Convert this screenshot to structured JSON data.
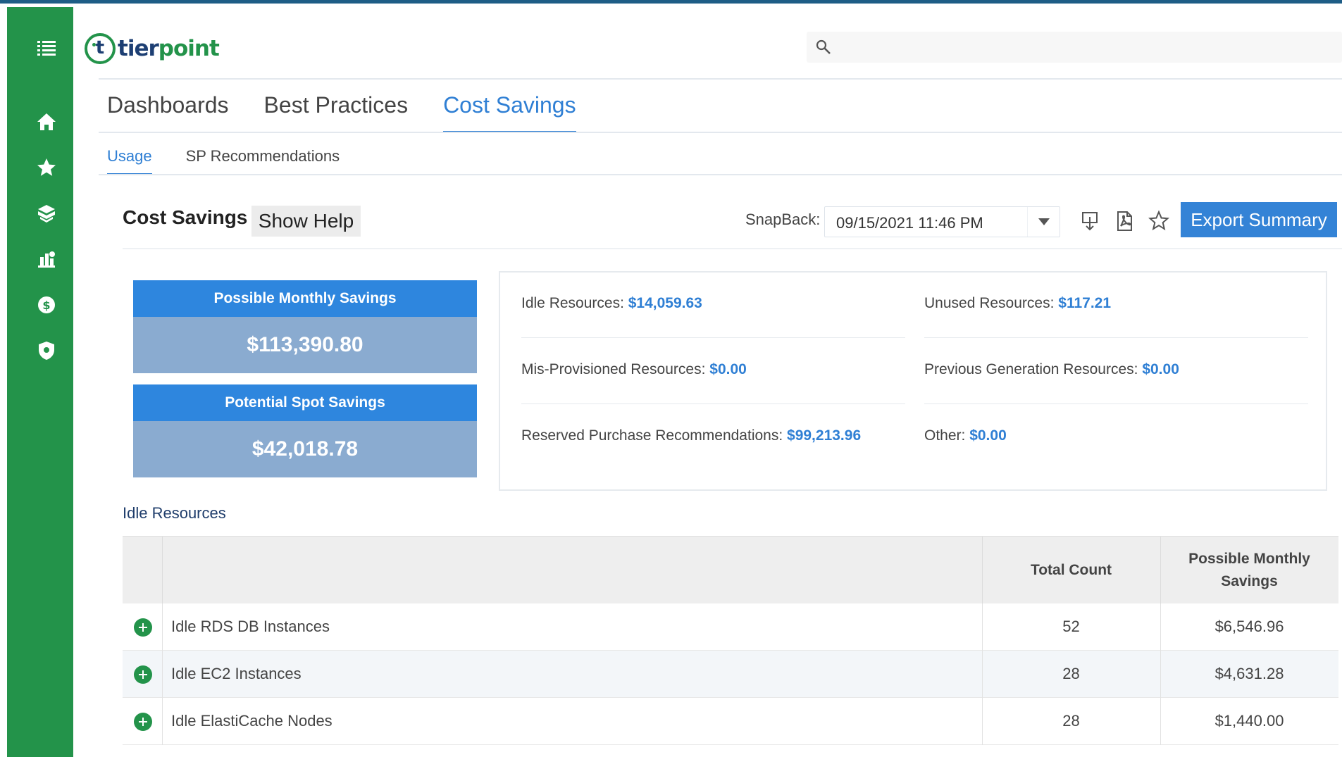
{
  "logo": {
    "mark_letter": "t",
    "text_part1": "tier",
    "text_part2": "point"
  },
  "search": {
    "placeholder": ""
  },
  "sidebar": {
    "items": [
      {
        "icon": "menu-icon"
      },
      {
        "icon": "home-icon"
      },
      {
        "icon": "star-icon"
      },
      {
        "icon": "cubes-icon"
      },
      {
        "icon": "building-icon"
      },
      {
        "icon": "dollar-circle-icon"
      },
      {
        "icon": "shield-icon"
      }
    ]
  },
  "main_tabs": [
    {
      "label": "Dashboards",
      "active": false
    },
    {
      "label": "Best Practices",
      "active": false
    },
    {
      "label": "Cost Savings",
      "active": true
    }
  ],
  "sub_tabs": [
    {
      "label": "Usage",
      "active": true
    },
    {
      "label": "SP Recommendations",
      "active": false
    }
  ],
  "toolbar": {
    "title": "Cost Savings",
    "show_help": "Show Help",
    "snapback_label": "SnapBack:",
    "snapback_value": "09/15/2021 11:46 PM",
    "export_label": "Export Summary"
  },
  "cards": [
    {
      "title": "Possible Monthly Savings",
      "value": "$113,390.80"
    },
    {
      "title": "Potential Spot Savings",
      "value": "$42,018.78"
    }
  ],
  "summary": [
    {
      "label": "Idle Resources: ",
      "value": "$14,059.63"
    },
    {
      "label": "Unused Resources: ",
      "value": "$117.21"
    },
    {
      "label": "Mis-Provisioned Resources: ",
      "value": "$0.00"
    },
    {
      "label": "Previous Generation Resources: ",
      "value": "$0.00"
    },
    {
      "label": "Reserved Purchase Recommendations: ",
      "value": "$99,213.96"
    },
    {
      "label": "Other: ",
      "value": "$0.00"
    }
  ],
  "idle_section": {
    "title": "Idle Resources",
    "columns": {
      "total_count": "Total Count",
      "savings_line1": "Possible Monthly",
      "savings_line2": "Savings"
    },
    "rows": [
      {
        "name": "Idle RDS DB Instances",
        "count": "52",
        "savings": "$6,546.96"
      },
      {
        "name": "Idle EC2 Instances",
        "count": "28",
        "savings": "$4,631.28"
      },
      {
        "name": "Idle ElastiCache Nodes",
        "count": "28",
        "savings": "$1,440.00"
      }
    ]
  },
  "colors": {
    "sidebar": "#23934a",
    "accent": "#2f7fd4",
    "card_head": "#2e86de",
    "card_body": "#8aabd0",
    "logo_navy": "#1d3f73"
  }
}
